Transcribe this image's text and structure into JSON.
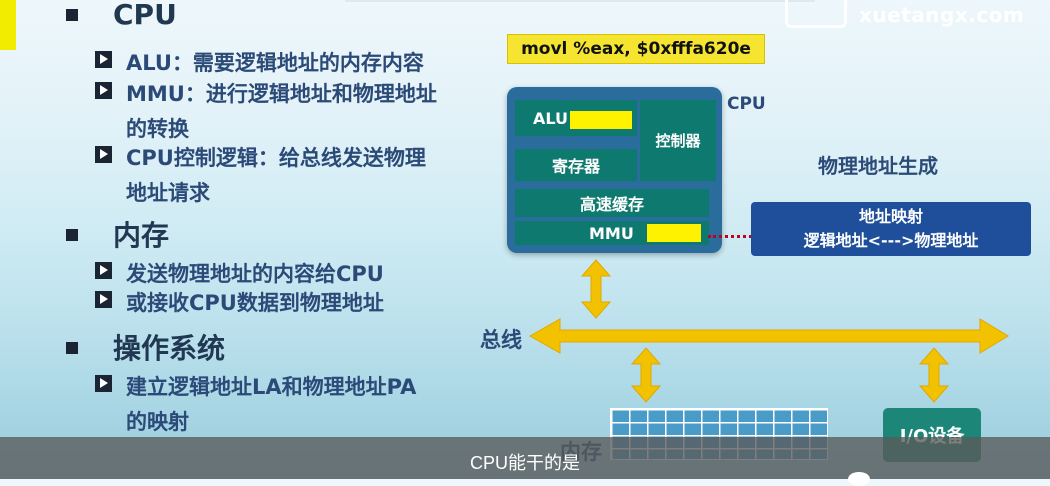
{
  "logo": {
    "text": "xuetangx.com"
  },
  "sections": [
    {
      "title": "CPU",
      "items": [
        {
          "lines": [
            "ALU：需要逻辑地址的内存内容"
          ]
        },
        {
          "lines": [
            "MMU：进行逻辑地址和物理地址",
            "的转换"
          ]
        },
        {
          "lines": [
            "CPU控制逻辑：给总线发送物理",
            "地址请求"
          ]
        }
      ]
    },
    {
      "title": "内存",
      "items": [
        {
          "lines": [
            "发送物理地址的内容给CPU"
          ]
        },
        {
          "lines": [
            "或接收CPU数据到物理地址"
          ]
        }
      ]
    },
    {
      "title": "操作系统",
      "items": [
        {
          "lines": [
            "建立逻辑地址LA和物理地址PA",
            "的映射"
          ]
        }
      ]
    }
  ],
  "diagram": {
    "instruction": "movl %eax, $0xfffa620e",
    "cpu_label": "CPU",
    "alu": "ALU",
    "registers": "寄存器",
    "controller": "控制器",
    "cache": "高速缓存",
    "mmu": "MMU",
    "phys_gen": "物理地址生成",
    "map_title": "地址映射",
    "map_sub": "逻辑地址<--->物理地址",
    "bus": "总线",
    "memory": "内存",
    "io": "I/O设备",
    "arrow_color": "#f2c200",
    "highlight_color": "#fff200"
  },
  "subtitle": "CPU能干的是"
}
